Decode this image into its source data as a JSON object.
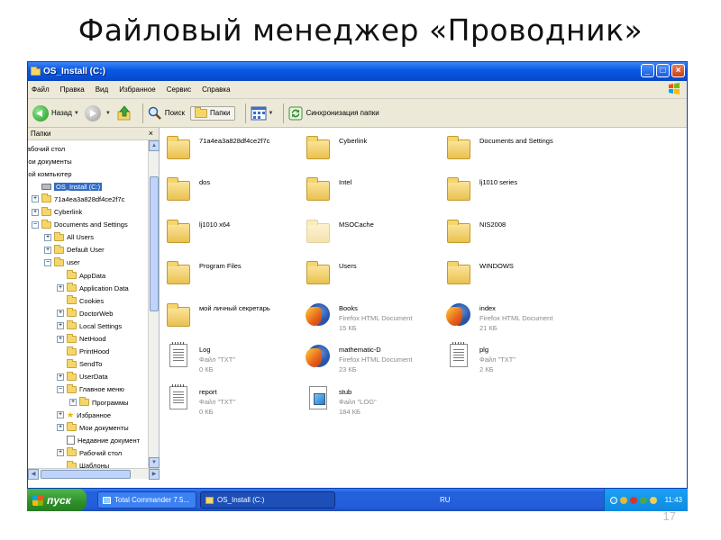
{
  "slide": {
    "title": "Файловый менеджер «Проводник»",
    "page_number": "17"
  },
  "window": {
    "title": "OS_Install (C:)",
    "controls": [
      "_",
      "□",
      "×"
    ]
  },
  "menu": [
    "Файл",
    "Правка",
    "Вид",
    "Избранное",
    "Сервис",
    "Справка"
  ],
  "toolbar": {
    "back_label": "Назад",
    "search_label": "Поиск",
    "folders_label": "Папки",
    "sync_label": "Синхронизация папки"
  },
  "sidebar": {
    "header": "Папки",
    "close": "×",
    "tree": [
      {
        "label": "Рабочий стол",
        "depth": 0,
        "exp": "",
        "icon": "none"
      },
      {
        "label": "Мои документы",
        "depth": 0,
        "exp": "",
        "icon": "none"
      },
      {
        "label": "Мой компьютер",
        "depth": 0,
        "exp": "",
        "icon": "none"
      },
      {
        "label": "OS_Install (C:)",
        "depth": 1,
        "exp": "",
        "icon": "drive",
        "selected": true
      },
      {
        "label": "71a4ea3a828df4ce2f7c",
        "depth": 1,
        "exp": "+",
        "icon": "folder"
      },
      {
        "label": "Cyberlink",
        "depth": 1,
        "exp": "+",
        "icon": "folder"
      },
      {
        "label": "Documents and Settings",
        "depth": 1,
        "exp": "−",
        "icon": "folder"
      },
      {
        "label": "All Users",
        "depth": 2,
        "exp": "+",
        "icon": "folder"
      },
      {
        "label": "Default User",
        "depth": 2,
        "exp": "+",
        "icon": "folder"
      },
      {
        "label": "user",
        "depth": 2,
        "exp": "−",
        "icon": "folder"
      },
      {
        "label": "AppData",
        "depth": 3,
        "exp": "",
        "icon": "folder"
      },
      {
        "label": "Application Data",
        "depth": 3,
        "exp": "+",
        "icon": "folder"
      },
      {
        "label": "Cookies",
        "depth": 3,
        "exp": "",
        "icon": "folder"
      },
      {
        "label": "DoctorWeb",
        "depth": 3,
        "exp": "+",
        "icon": "folder"
      },
      {
        "label": "Local Settings",
        "depth": 3,
        "exp": "+",
        "icon": "folder"
      },
      {
        "label": "NetHood",
        "depth": 3,
        "exp": "+",
        "icon": "folder"
      },
      {
        "label": "PrintHood",
        "depth": 3,
        "exp": "",
        "icon": "folder"
      },
      {
        "label": "SendTo",
        "depth": 3,
        "exp": "",
        "icon": "folder"
      },
      {
        "label": "UserData",
        "depth": 3,
        "exp": "+",
        "icon": "folder"
      },
      {
        "label": "Главное меню",
        "depth": 3,
        "exp": "−",
        "icon": "folder"
      },
      {
        "label": "Программы",
        "depth": 4,
        "exp": "+",
        "icon": "folder"
      },
      {
        "label": "Избранное",
        "depth": 3,
        "exp": "+",
        "icon": "star"
      },
      {
        "label": "Мои документы",
        "depth": 3,
        "exp": "+",
        "icon": "folder"
      },
      {
        "label": "Недавние документ",
        "depth": 3,
        "exp": "",
        "icon": "doc"
      },
      {
        "label": "Рабочий стол",
        "depth": 3,
        "exp": "+",
        "icon": "folder"
      },
      {
        "label": "Шаблоны",
        "depth": 3,
        "exp": "",
        "icon": "folder"
      }
    ]
  },
  "files": [
    {
      "name": "71a4ea3a828df4ce2f7c",
      "type": "",
      "size": "",
      "icon": "folder"
    },
    {
      "name": "Cyberlink",
      "type": "",
      "size": "",
      "icon": "folder"
    },
    {
      "name": "Documents and Settings",
      "type": "",
      "size": "",
      "icon": "folder"
    },
    {
      "name": "dos",
      "type": "",
      "size": "",
      "icon": "folder"
    },
    {
      "name": "Intel",
      "type": "",
      "size": "",
      "icon": "folder"
    },
    {
      "name": "lj1010 series",
      "type": "",
      "size": "",
      "icon": "folder"
    },
    {
      "name": "lj1010 x64",
      "type": "",
      "size": "",
      "icon": "folder"
    },
    {
      "name": "MSOCache",
      "type": "",
      "size": "",
      "icon": "folder-faded"
    },
    {
      "name": "NIS2008",
      "type": "",
      "size": "",
      "icon": "folder"
    },
    {
      "name": "Program Files",
      "type": "",
      "size": "",
      "icon": "folder"
    },
    {
      "name": "Users",
      "type": "",
      "size": "",
      "icon": "folder"
    },
    {
      "name": "WINDOWS",
      "type": "",
      "size": "",
      "icon": "folder"
    },
    {
      "name": "мой личный секретарь",
      "type": "",
      "size": "",
      "icon": "folder"
    },
    {
      "name": "Books",
      "type": "Firefox HTML Document",
      "size": "15 КБ",
      "icon": "firefox"
    },
    {
      "name": "index",
      "type": "Firefox HTML Document",
      "size": "21 КБ",
      "icon": "firefox"
    },
    {
      "name": "Log",
      "type": "Файл \"TXT\"",
      "size": "0 КБ",
      "icon": "txt"
    },
    {
      "name": "mathematic-D",
      "type": "Firefox HTML Document",
      "size": "23 КБ",
      "icon": "firefox"
    },
    {
      "name": "plg",
      "type": "Файл \"TXT\"",
      "size": "2 КБ",
      "icon": "txt"
    },
    {
      "name": "report",
      "type": "Файл \"TXT\"",
      "size": "0 КБ",
      "icon": "txt"
    },
    {
      "name": "stub",
      "type": "Файл \"LOG\"",
      "size": "184 КБ",
      "icon": "log"
    }
  ],
  "taskbar": {
    "start_label": "пуск",
    "tasks": [
      {
        "label": "Total Commander 7.5...",
        "active": false
      },
      {
        "label": "OS_Install (C:)",
        "active": true
      }
    ],
    "language": "RU",
    "clock": "11:43"
  },
  "colors": {
    "titlebar": "#0a5ae6",
    "selection": "#316ac5",
    "taskbar": "#245edb",
    "start_button": "#2f8f2a"
  }
}
